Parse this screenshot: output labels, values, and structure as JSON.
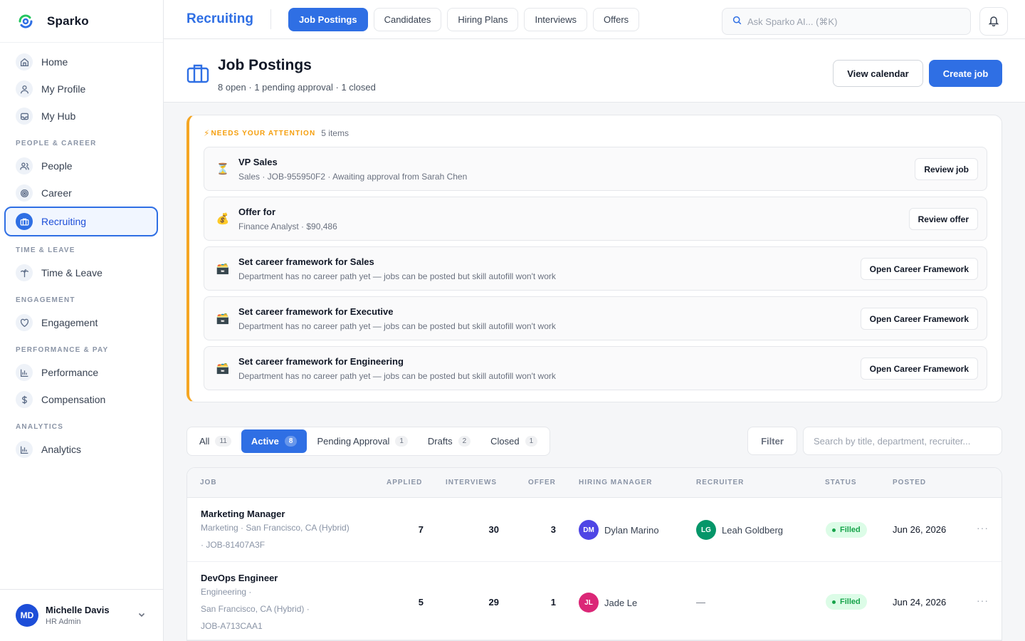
{
  "brand": {
    "name": "Sparko"
  },
  "sidebar": {
    "items_top": [
      {
        "label": "Home",
        "icon": "home-icon"
      },
      {
        "label": "My Profile",
        "icon": "user-icon"
      },
      {
        "label": "My Hub",
        "icon": "inbox-icon"
      }
    ],
    "sections": [
      {
        "title": "PEOPLE & CAREER",
        "items": [
          {
            "label": "People",
            "icon": "users-icon"
          },
          {
            "label": "Career",
            "icon": "target-icon"
          },
          {
            "label": "Recruiting",
            "icon": "briefcase-icon",
            "active": true
          }
        ]
      },
      {
        "title": "TIME & LEAVE",
        "items": [
          {
            "label": "Time & Leave",
            "icon": "palm-tree-icon"
          }
        ]
      },
      {
        "title": "ENGAGEMENT",
        "items": [
          {
            "label": "Engagement",
            "icon": "heart-icon"
          }
        ]
      },
      {
        "title": "PERFORMANCE & PAY",
        "items": [
          {
            "label": "Performance",
            "icon": "bar-chart-icon"
          },
          {
            "label": "Compensation",
            "icon": "dollar-icon"
          }
        ]
      },
      {
        "title": "ANALYTICS",
        "items": [
          {
            "label": "Analytics",
            "icon": "bar-chart-icon"
          }
        ]
      }
    ],
    "user": {
      "initials": "MD",
      "name": "Michelle Davis",
      "role": "HR Admin"
    }
  },
  "topbar": {
    "title": "Recruiting",
    "tabs": [
      "Job Postings",
      "Candidates",
      "Hiring Plans",
      "Interviews",
      "Offers"
    ],
    "active_tab": 0,
    "search_placeholder": "Ask Sparko AI... (⌘K)"
  },
  "page": {
    "title": "Job Postings",
    "subtitle": "8 open · 1 pending approval · 1 closed",
    "view_calendar": "View calendar",
    "create_job": "Create job"
  },
  "attention": {
    "label": "NEEDS YOUR ATTENTION",
    "count": "5 items",
    "items": [
      {
        "emoji": "⏳",
        "title": "VP Sales",
        "desc": "Sales · JOB-955950F2 · Awaiting approval from Sarah Chen",
        "action": "Review job"
      },
      {
        "emoji": "💰",
        "title": "Offer for",
        "desc": "Finance Analyst · $90,486",
        "action": "Review offer"
      },
      {
        "emoji": "🗃️",
        "title": "Set career framework for Sales",
        "desc": "Department has no career path yet — jobs can be posted but skill autofill won't work",
        "action": "Open Career Framework"
      },
      {
        "emoji": "🗃️",
        "title": "Set career framework for Executive",
        "desc": "Department has no career path yet — jobs can be posted but skill autofill won't work",
        "action": "Open Career Framework"
      },
      {
        "emoji": "🗃️",
        "title": "Set career framework for Engineering",
        "desc": "Department has no career path yet — jobs can be posted but skill autofill won't work",
        "action": "Open Career Framework"
      }
    ]
  },
  "filters": {
    "segments": [
      {
        "label": "All",
        "count": "11"
      },
      {
        "label": "Active",
        "count": "8",
        "active": true
      },
      {
        "label": "Pending Approval",
        "count": "1"
      },
      {
        "label": "Drafts",
        "count": "2"
      },
      {
        "label": "Closed",
        "count": "1"
      }
    ],
    "filter_label": "Filter",
    "search_placeholder": "Search by title, department, recruiter..."
  },
  "table": {
    "columns": [
      "JOB",
      "APPLIED",
      "INTERVIEWS",
      "OFFER",
      "HIRING MANAGER",
      "RECRUITER",
      "STATUS",
      "POSTED"
    ],
    "rows": [
      {
        "title": "Marketing Manager",
        "meta1": "Marketing  ·  San Francisco, CA (Hybrid)",
        "meta2": "·  JOB-81407A3F",
        "meta3": "",
        "applied": "7",
        "interviews": "30",
        "offer": "3",
        "manager": {
          "initials": "DM",
          "name": "Dylan Marino",
          "color": "#4f46e5"
        },
        "recruiter": {
          "initials": "LG",
          "name": "Leah Goldberg",
          "color": "#059669"
        },
        "status": "Filled",
        "posted": "Jun 26, 2026"
      },
      {
        "title": "DevOps Engineer",
        "meta1": "Engineering  ·",
        "meta2": "San Francisco, CA (Hybrid)  ·",
        "meta3": "JOB-A713CAA1",
        "applied": "5",
        "interviews": "29",
        "offer": "1",
        "manager": {
          "initials": "JL",
          "name": "Jade Le",
          "color": "#db2777"
        },
        "recruiter": {
          "initials": "",
          "name": "—",
          "color": ""
        },
        "status": "Filled",
        "posted": "Jun 24, 2026"
      }
    ]
  },
  "colors": {
    "accent": "#2f6fe4",
    "attention": "#f5a623",
    "success": "#16a34a"
  }
}
